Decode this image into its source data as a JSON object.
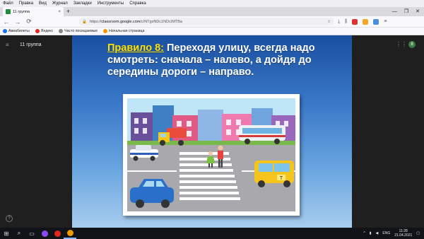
{
  "menubar": [
    "Файл",
    "Правка",
    "Вид",
    "Журнал",
    "Закладки",
    "Инструменты",
    "Справка"
  ],
  "tab": {
    "title": "11 группа",
    "close": "×"
  },
  "newtab": "+",
  "window_controls": [
    "—",
    "❐",
    "✕"
  ],
  "nav": {
    "back": "←",
    "forward": "→",
    "reload": "⟳"
  },
  "url": {
    "scheme": "https://",
    "host": "classroom.google.com",
    "path": "/c/NTgxNDc1NDcIMTBa"
  },
  "bookmarks": [
    "Авиабилеты",
    "Яндекс",
    "Часто посещаемые",
    "Начальная страница"
  ],
  "classroom": {
    "title": "11 группа",
    "menu": "≡",
    "apps": "⋮⋮⋮",
    "avatar": "8",
    "help": "?"
  },
  "slide": {
    "rule_label": "Правило 8:",
    "rule_text": " Переходя улицу, всегда надо смотреть: сначала – налево, а дойдя до середины дороги – направо."
  },
  "illustration": {
    "taxi_sign": "T"
  },
  "taskbar": {
    "start": "⊞",
    "search": "⌕"
  },
  "tray": {
    "lang": "ENG",
    "time": "11:28",
    "date": "21.04.2021"
  },
  "colors": {
    "slide_top": "#1a4fa0",
    "rule_label": "#ffe400",
    "classroom_bg": "#1f1f1f"
  }
}
